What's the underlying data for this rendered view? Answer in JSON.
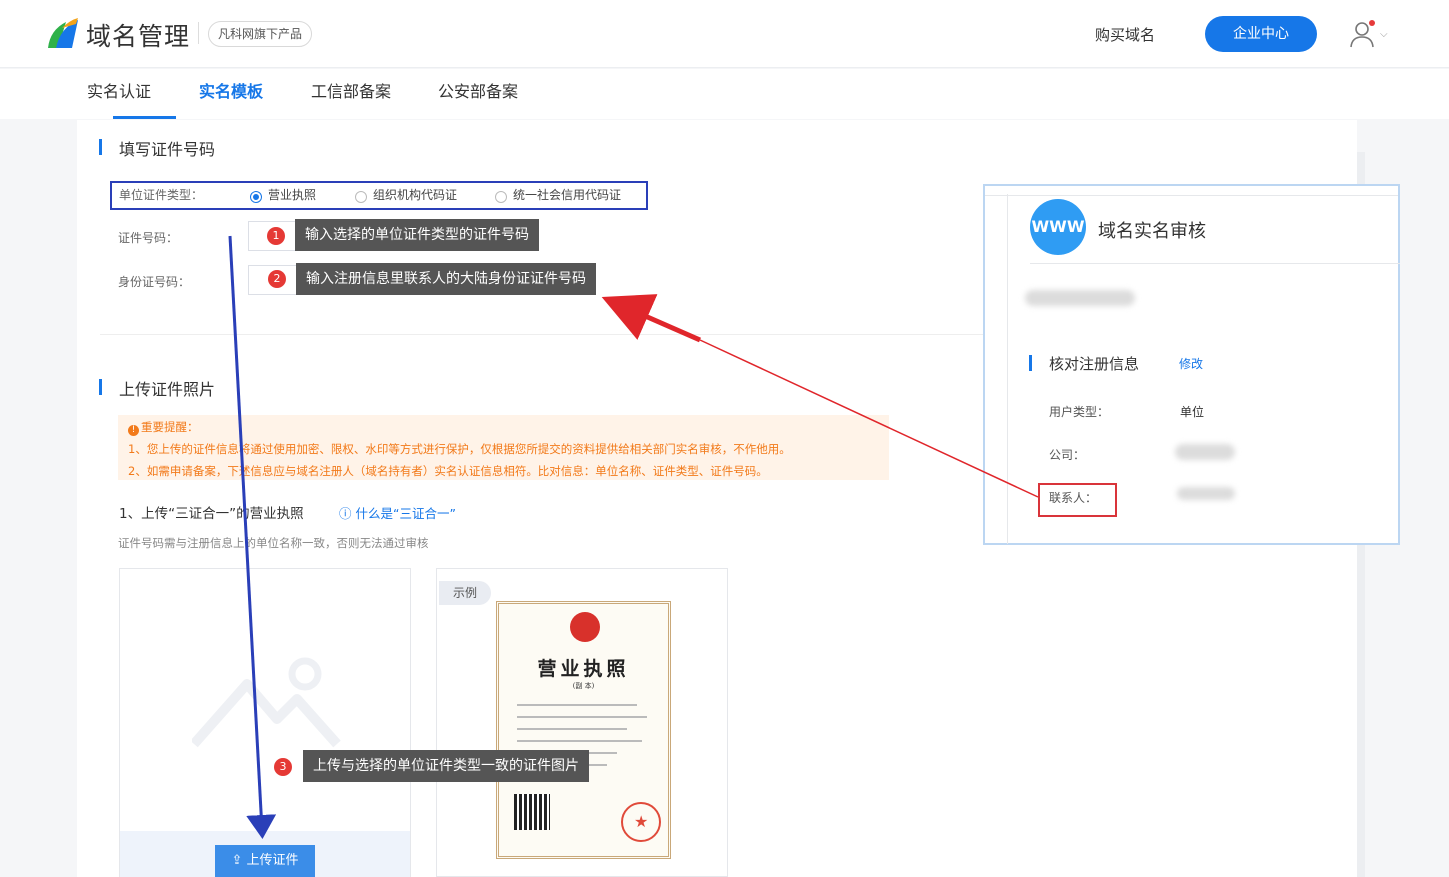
{
  "header": {
    "brand": "域名管理",
    "sub_badge": "凡科网旗下产品",
    "buy_link": "购买域名",
    "enterprise_button": "企业中心"
  },
  "tabs": [
    {
      "label": "实名认证"
    },
    {
      "label": "实名模板"
    },
    {
      "label": "工信部备案"
    },
    {
      "label": "公安部备案"
    }
  ],
  "form": {
    "section_title": "填写证件号码",
    "type_label": "单位证件类型：",
    "type_options": [
      "营业执照",
      "组织机构代码证",
      "统一社会信用代码证"
    ],
    "selected_option": "营业执照",
    "cert_label": "证件号码：",
    "id_label": "身份证号码："
  },
  "tips": [
    {
      "num": "1",
      "text": "输入选择的单位证件类型的证件号码"
    },
    {
      "num": "2",
      "text": "输入注册信息里联系人的大陆身份证证件号码"
    },
    {
      "num": "3",
      "text": "上传与选择的单位证件类型一致的证件图片"
    }
  ],
  "upload": {
    "section_title": "上传证件照片",
    "notice_title": "重要提醒：",
    "notice_lines": [
      "1、您上传的证件信息将通过使用加密、限权、水印等方式进行保护，仅根据您所提交的资料提供给相关部门实名审核，不作他用。",
      "2、如需申请备案，下述信息应与域名注册人（域名持有者）实名认证信息相符。比对信息：单位名称、证件类型、证件号码。"
    ],
    "heading": "1、上传“三证合一”的营业执照",
    "what_link": "什么是“三证合一”",
    "hint": "证件号码需与注册信息上的单位名称一致，否则无法通过审核",
    "button": "上传证件",
    "sample_tag": "示例",
    "license_title": "营业执照",
    "license_sub": "(副 本)"
  },
  "review_panel": {
    "icon_text": "WWW",
    "title": "域名实名审核",
    "section": "核对注册信息",
    "edit": "修改",
    "rows": [
      {
        "label": "用户类型：",
        "value": "单位"
      },
      {
        "label": "公司：",
        "value": ""
      },
      {
        "label": "联系人：",
        "value": ""
      }
    ]
  },
  "colors": {
    "accent": "#1677e8",
    "annotation_red": "#e53935",
    "annotation_blue": "#2a3fb8",
    "notice_orange": "#f27a1a"
  }
}
